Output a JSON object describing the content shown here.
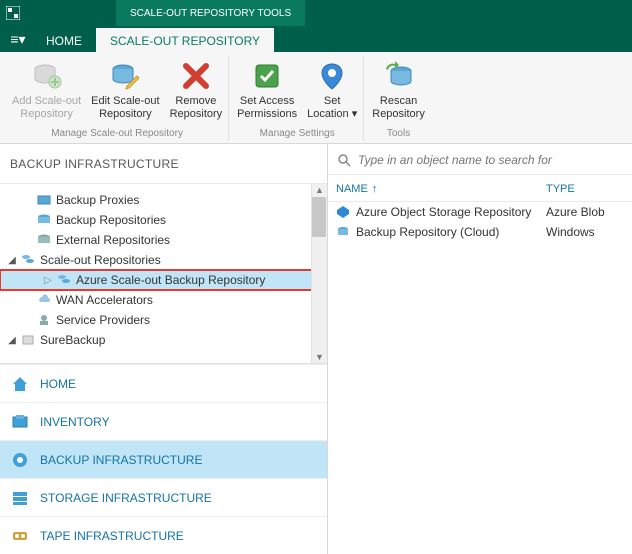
{
  "titlebar": {
    "context_tab": "SCALE-OUT REPOSITORY TOOLS"
  },
  "tabs": {
    "menu_icon": "≡▾",
    "home": "HOME",
    "scaleout": "SCALE-OUT REPOSITORY"
  },
  "ribbon": {
    "groups": {
      "manage_repo": {
        "label": "Manage  Scale-out Repository",
        "add": {
          "line1": "Add Scale-out",
          "line2": "Repository"
        },
        "edit": {
          "line1": "Edit Scale-out",
          "line2": "Repository"
        },
        "remove": {
          "line1": "Remove",
          "line2": "Repository"
        }
      },
      "manage_settings": {
        "label": "Manage Settings",
        "access": {
          "line1": "Set Access",
          "line2": "Permissions"
        },
        "location": {
          "line1": "Set",
          "line2": "Location ▾"
        }
      },
      "tools": {
        "label": "Tools",
        "rescan": {
          "line1": "Rescan",
          "line2": "Repository"
        }
      }
    }
  },
  "left": {
    "header": "BACKUP INFRASTRUCTURE",
    "tree": {
      "backup_proxies": "Backup Proxies",
      "backup_repositories": "Backup Repositories",
      "external_repositories": "External Repositories",
      "scaleout_repositories": "Scale-out Repositories",
      "azure_scaleout": "Azure Scale-out Backup Repository",
      "wan_accelerators": "WAN Accelerators",
      "service_providers": "Service Providers",
      "surebackup": "SureBackup"
    },
    "nav": {
      "home": "HOME",
      "inventory": "INVENTORY",
      "backup_infra": "BACKUP INFRASTRUCTURE",
      "storage_infra": "STORAGE INFRASTRUCTURE",
      "tape_infra": "TAPE INFRASTRUCTURE"
    }
  },
  "right": {
    "search_placeholder": "Type in an object name to search for",
    "columns": {
      "name": "NAME",
      "type": "TYPE",
      "sort_arrow": "↑"
    },
    "rows": [
      {
        "name": "Azure Object Storage Repository",
        "type": "Azure Blob"
      },
      {
        "name": "Backup Repository (Cloud)",
        "type": "Windows"
      }
    ]
  }
}
